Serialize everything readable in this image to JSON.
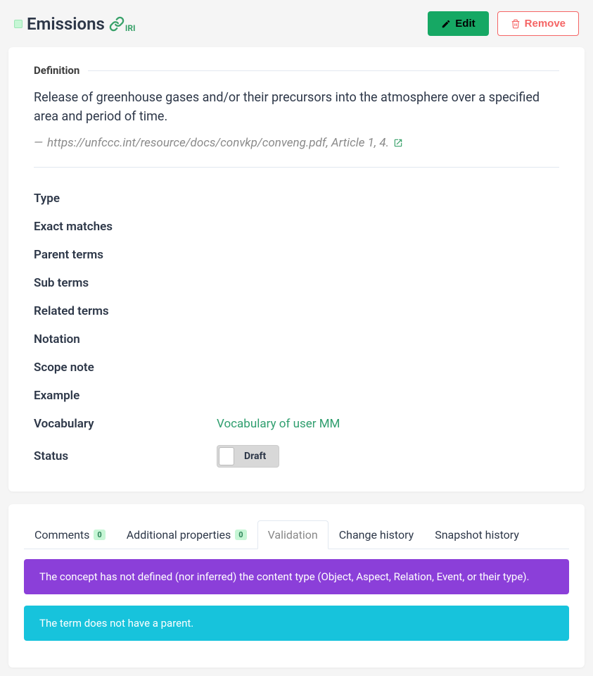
{
  "header": {
    "title": "Emissions",
    "iri_label": "IRI",
    "edit_label": "Edit",
    "remove_label": "Remove"
  },
  "definition": {
    "section_label": "Definition",
    "text": "Release of greenhouse gases and/or their precursors into the atmosphere over a specified area and period of time.",
    "source_prefix": "—",
    "source_text": "https://unfccc.int/resource/docs/convkp/conveng.pdf, Article 1, 4."
  },
  "fields": {
    "type": "Type",
    "exact_matches": "Exact matches",
    "parent_terms": "Parent terms",
    "sub_terms": "Sub terms",
    "related_terms": "Related terms",
    "notation": "Notation",
    "scope_note": "Scope note",
    "example": "Example",
    "vocabulary_label": "Vocabulary",
    "vocabulary_value": "Vocabulary of user MM",
    "status_label": "Status",
    "status_value": "Draft"
  },
  "tabs": {
    "comments": {
      "label": "Comments",
      "count": "0"
    },
    "additional": {
      "label": "Additional properties",
      "count": "0"
    },
    "validation": {
      "label": "Validation"
    },
    "change_history": {
      "label": "Change history"
    },
    "snapshot_history": {
      "label": "Snapshot history"
    }
  },
  "validation_messages": {
    "msg1": "The concept has not defined (nor inferred) the content type (Object, Aspect, Relation, Event, or their type).",
    "msg2": "The term does not have a parent."
  }
}
